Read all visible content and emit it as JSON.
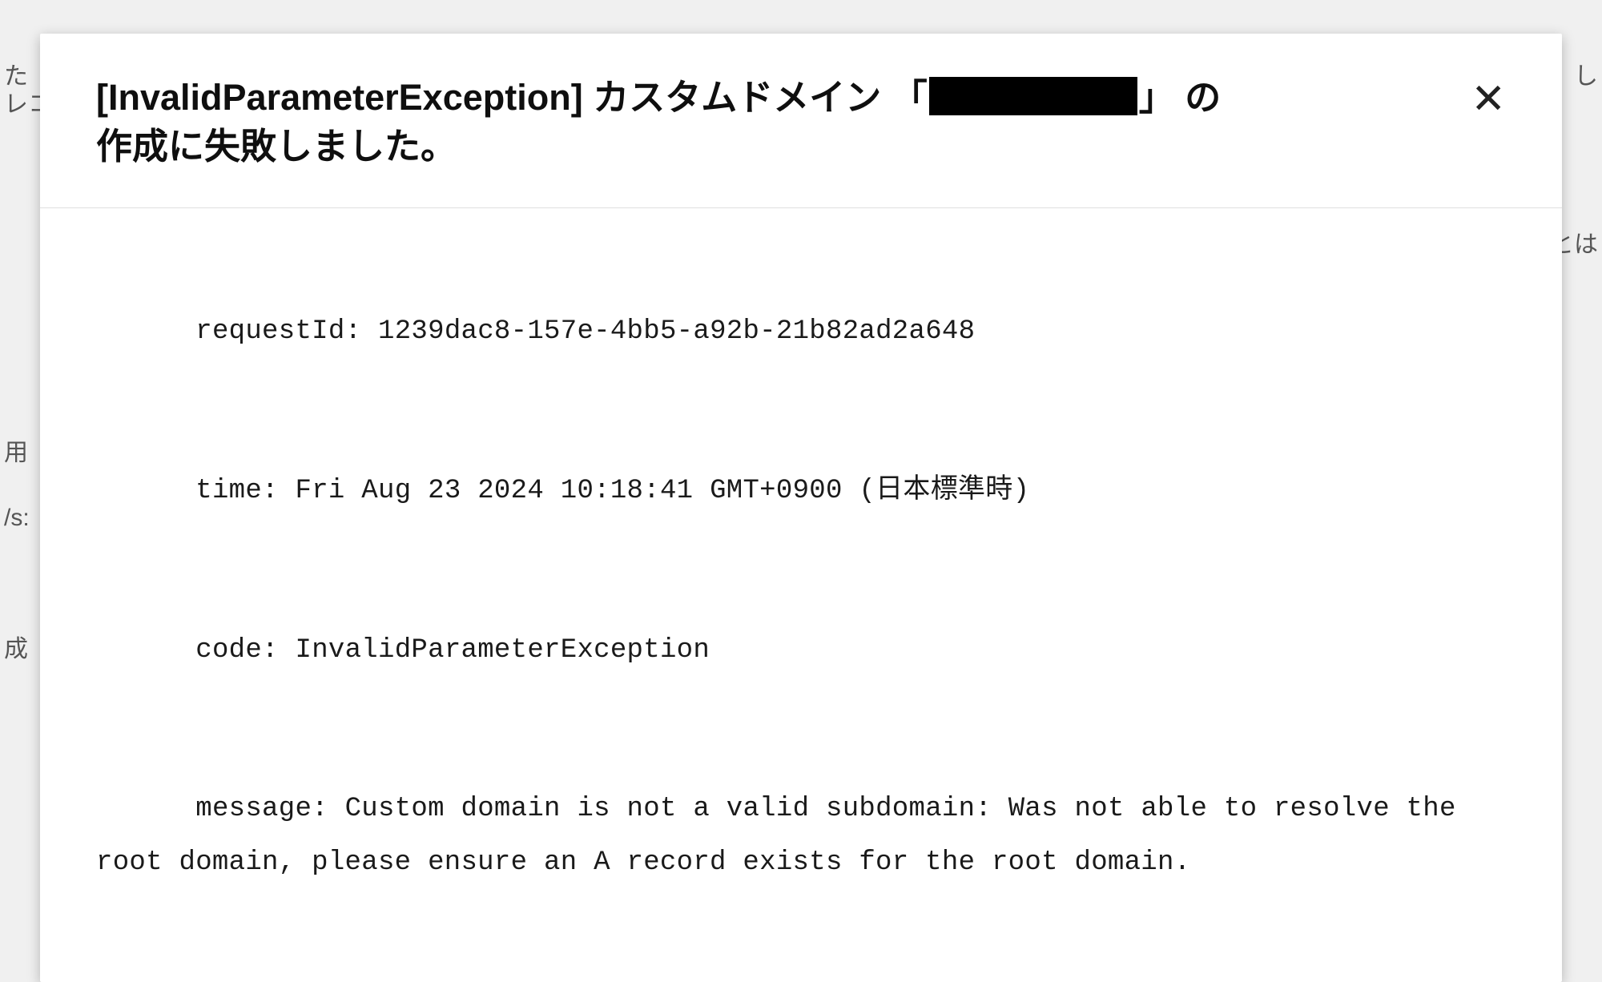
{
  "background": {
    "bg1": "た",
    "bg2": "レコ",
    "bg3": "",
    "bg4": "用",
    "bg5": "/s:",
    "bg6": "成",
    "bg7": "とは",
    "bg8": "し"
  },
  "dialog": {
    "title": {
      "prefix": "[InvalidParameterException] ",
      "domain_before": "カスタムドメイン 「",
      "domain_after": "」 の",
      "suffix": "作成に失敗しました。"
    },
    "close_icon_name": "close-icon",
    "body": {
      "requestId_label": "requestId:",
      "requestId_value": "1239dac8-157e-4bb5-a92b-21b82ad2a648",
      "time_label": "time:",
      "time_value": "Fri Aug 23 2024 10:18:41 GMT+0900 (日本標準時)",
      "code_label": "code:",
      "code_value": "InvalidParameterException",
      "message_label": "message:",
      "message_value": "Custom domain is not a valid subdomain: Was not able to resolve the root domain, please ensure an A record exists for the root domain."
    }
  }
}
